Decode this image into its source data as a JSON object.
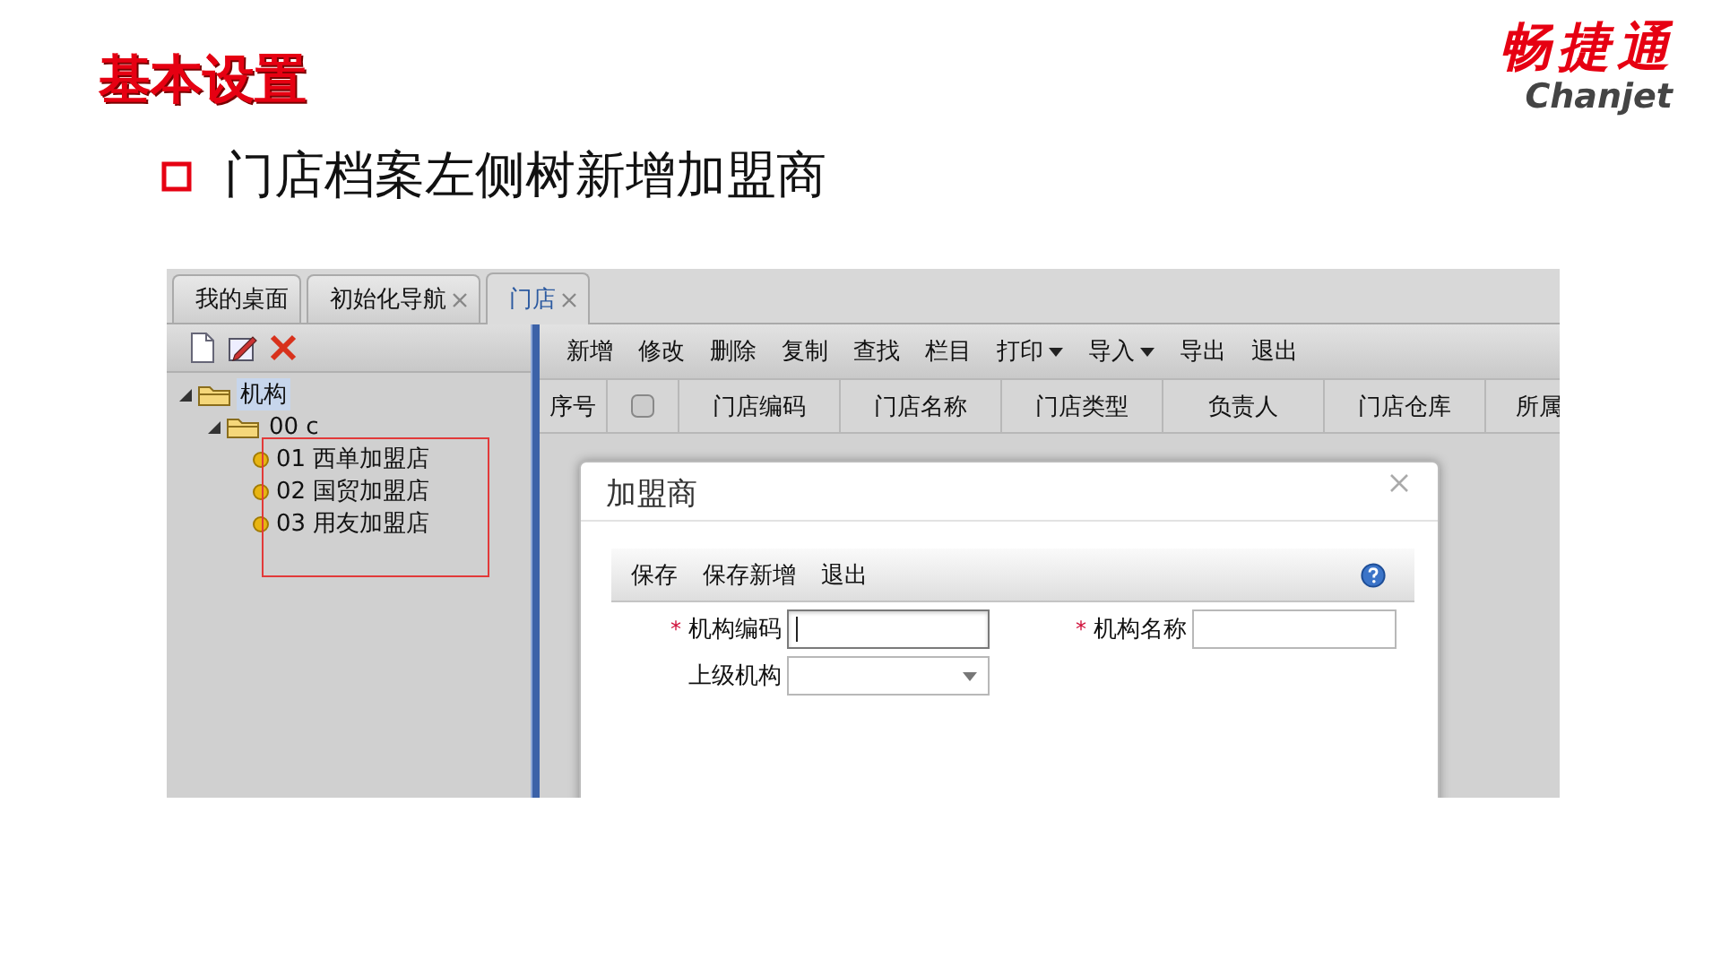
{
  "slide": {
    "title": "基本设置",
    "bullet": "门店档案左侧树新增加盟商",
    "logo": {
      "name": "畅捷通",
      "latin": "Chanjet"
    }
  },
  "app": {
    "tabs": [
      {
        "label": "我的桌面",
        "selected": false,
        "closable": false
      },
      {
        "label": "初始化导航",
        "selected": false,
        "closable": true
      },
      {
        "label": "门店",
        "selected": true,
        "closable": true
      }
    ],
    "tree": [
      {
        "label": "机构",
        "kind": "folder",
        "expanded": true,
        "selected": true,
        "children": [
          {
            "label": "00 c",
            "kind": "folder",
            "expanded": true,
            "selected": false,
            "children": [
              {
                "label": "01 西单加盟店",
                "kind": "leaf",
                "selected": false
              },
              {
                "label": "02 国贸加盟店",
                "kind": "leaf",
                "selected": false
              },
              {
                "label": "03 用友加盟店",
                "kind": "leaf",
                "selected": false
              }
            ]
          }
        ]
      }
    ],
    "toolbar": [
      {
        "label": "新增",
        "has_menu": false
      },
      {
        "label": "修改",
        "has_menu": false
      },
      {
        "label": "删除",
        "has_menu": false
      },
      {
        "label": "复制",
        "has_menu": false
      },
      {
        "label": "查找",
        "has_menu": false
      },
      {
        "label": "栏目",
        "has_menu": false
      },
      {
        "label": "打印",
        "has_menu": true
      },
      {
        "label": "导入",
        "has_menu": true
      },
      {
        "label": "导出",
        "has_menu": false
      },
      {
        "label": "退出",
        "has_menu": false
      }
    ],
    "columns": [
      {
        "kind": "text",
        "label": "序号"
      },
      {
        "kind": "checkbox",
        "checked": false
      },
      {
        "kind": "text",
        "label": "门店编码"
      },
      {
        "kind": "text",
        "label": "门店名称"
      },
      {
        "kind": "text",
        "label": "门店类型"
      },
      {
        "kind": "text",
        "label": "负责人"
      },
      {
        "kind": "text",
        "label": "门店仓库"
      },
      {
        "kind": "text",
        "label": "所属"
      }
    ],
    "dialog": {
      "title": "加盟商",
      "toolbar": [
        "保存",
        "保存新增",
        "退出"
      ],
      "fields": [
        {
          "mark": "*",
          "label": "机构编码",
          "kind": "text",
          "focused": true
        },
        {
          "mark": "*",
          "label": "机构名称",
          "kind": "text",
          "focused": false
        },
        {
          "label": "上级机构",
          "kind": "select",
          "focused": false
        }
      ]
    }
  }
}
